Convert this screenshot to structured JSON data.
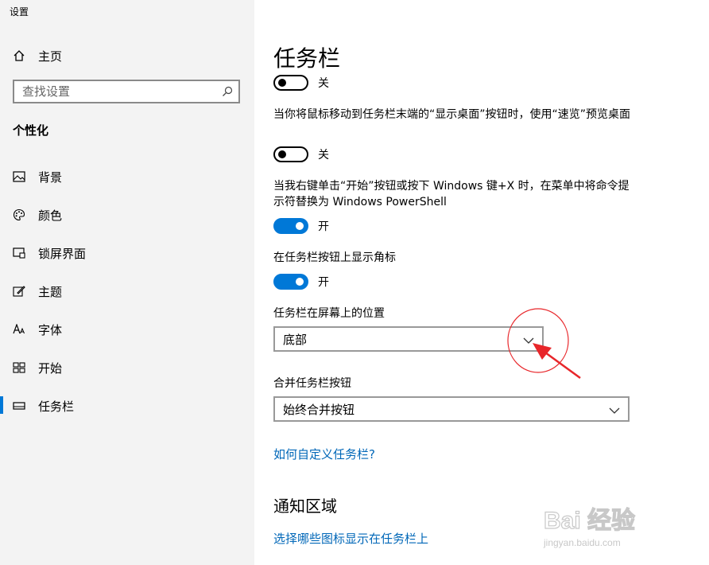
{
  "app": {
    "title": "设置"
  },
  "sidebar": {
    "home_label": "主页",
    "search_placeholder": "查找设置",
    "section_title": "个性化",
    "items": [
      {
        "label": "背景",
        "icon": "image-icon"
      },
      {
        "label": "颜色",
        "icon": "palette-icon"
      },
      {
        "label": "锁屏界面",
        "icon": "lock-screen-icon"
      },
      {
        "label": "主题",
        "icon": "theme-brush-icon"
      },
      {
        "label": "字体",
        "icon": "font-icon"
      },
      {
        "label": "开始",
        "icon": "start-icon"
      },
      {
        "label": "任务栏",
        "icon": "taskbar-icon",
        "active": true
      }
    ]
  },
  "main": {
    "title": "任务栏",
    "settings": [
      {
        "description": "",
        "state": "关",
        "on": false
      },
      {
        "description": "当你将鼠标移动到任务栏末端的“显示桌面”按钮时，使用“速览”预览桌面",
        "state": "关",
        "on": false
      },
      {
        "description": "当我右键单击“开始”按钮或按下 Windows 键+X 时，在菜单中将命令提示符替换为 Windows PowerShell",
        "state": "开",
        "on": true
      },
      {
        "description": "在任务栏按钮上显示角标",
        "state": "开",
        "on": true
      }
    ],
    "position": {
      "label": "任务栏在屏幕上的位置",
      "value": "底部"
    },
    "combine": {
      "label": "合并任务栏按钮",
      "value": "始终合并按钮"
    },
    "customize_link": "如何自定义任务栏?",
    "notification": {
      "title": "通知区域",
      "link": "选择哪些图标显示在任务栏上"
    }
  },
  "watermark": {
    "main": "Bai 经验",
    "url": "jingyan.baidu.com"
  },
  "colors": {
    "accent": "#0078d7",
    "link": "#0067b8",
    "annotation": "#e8262a"
  }
}
